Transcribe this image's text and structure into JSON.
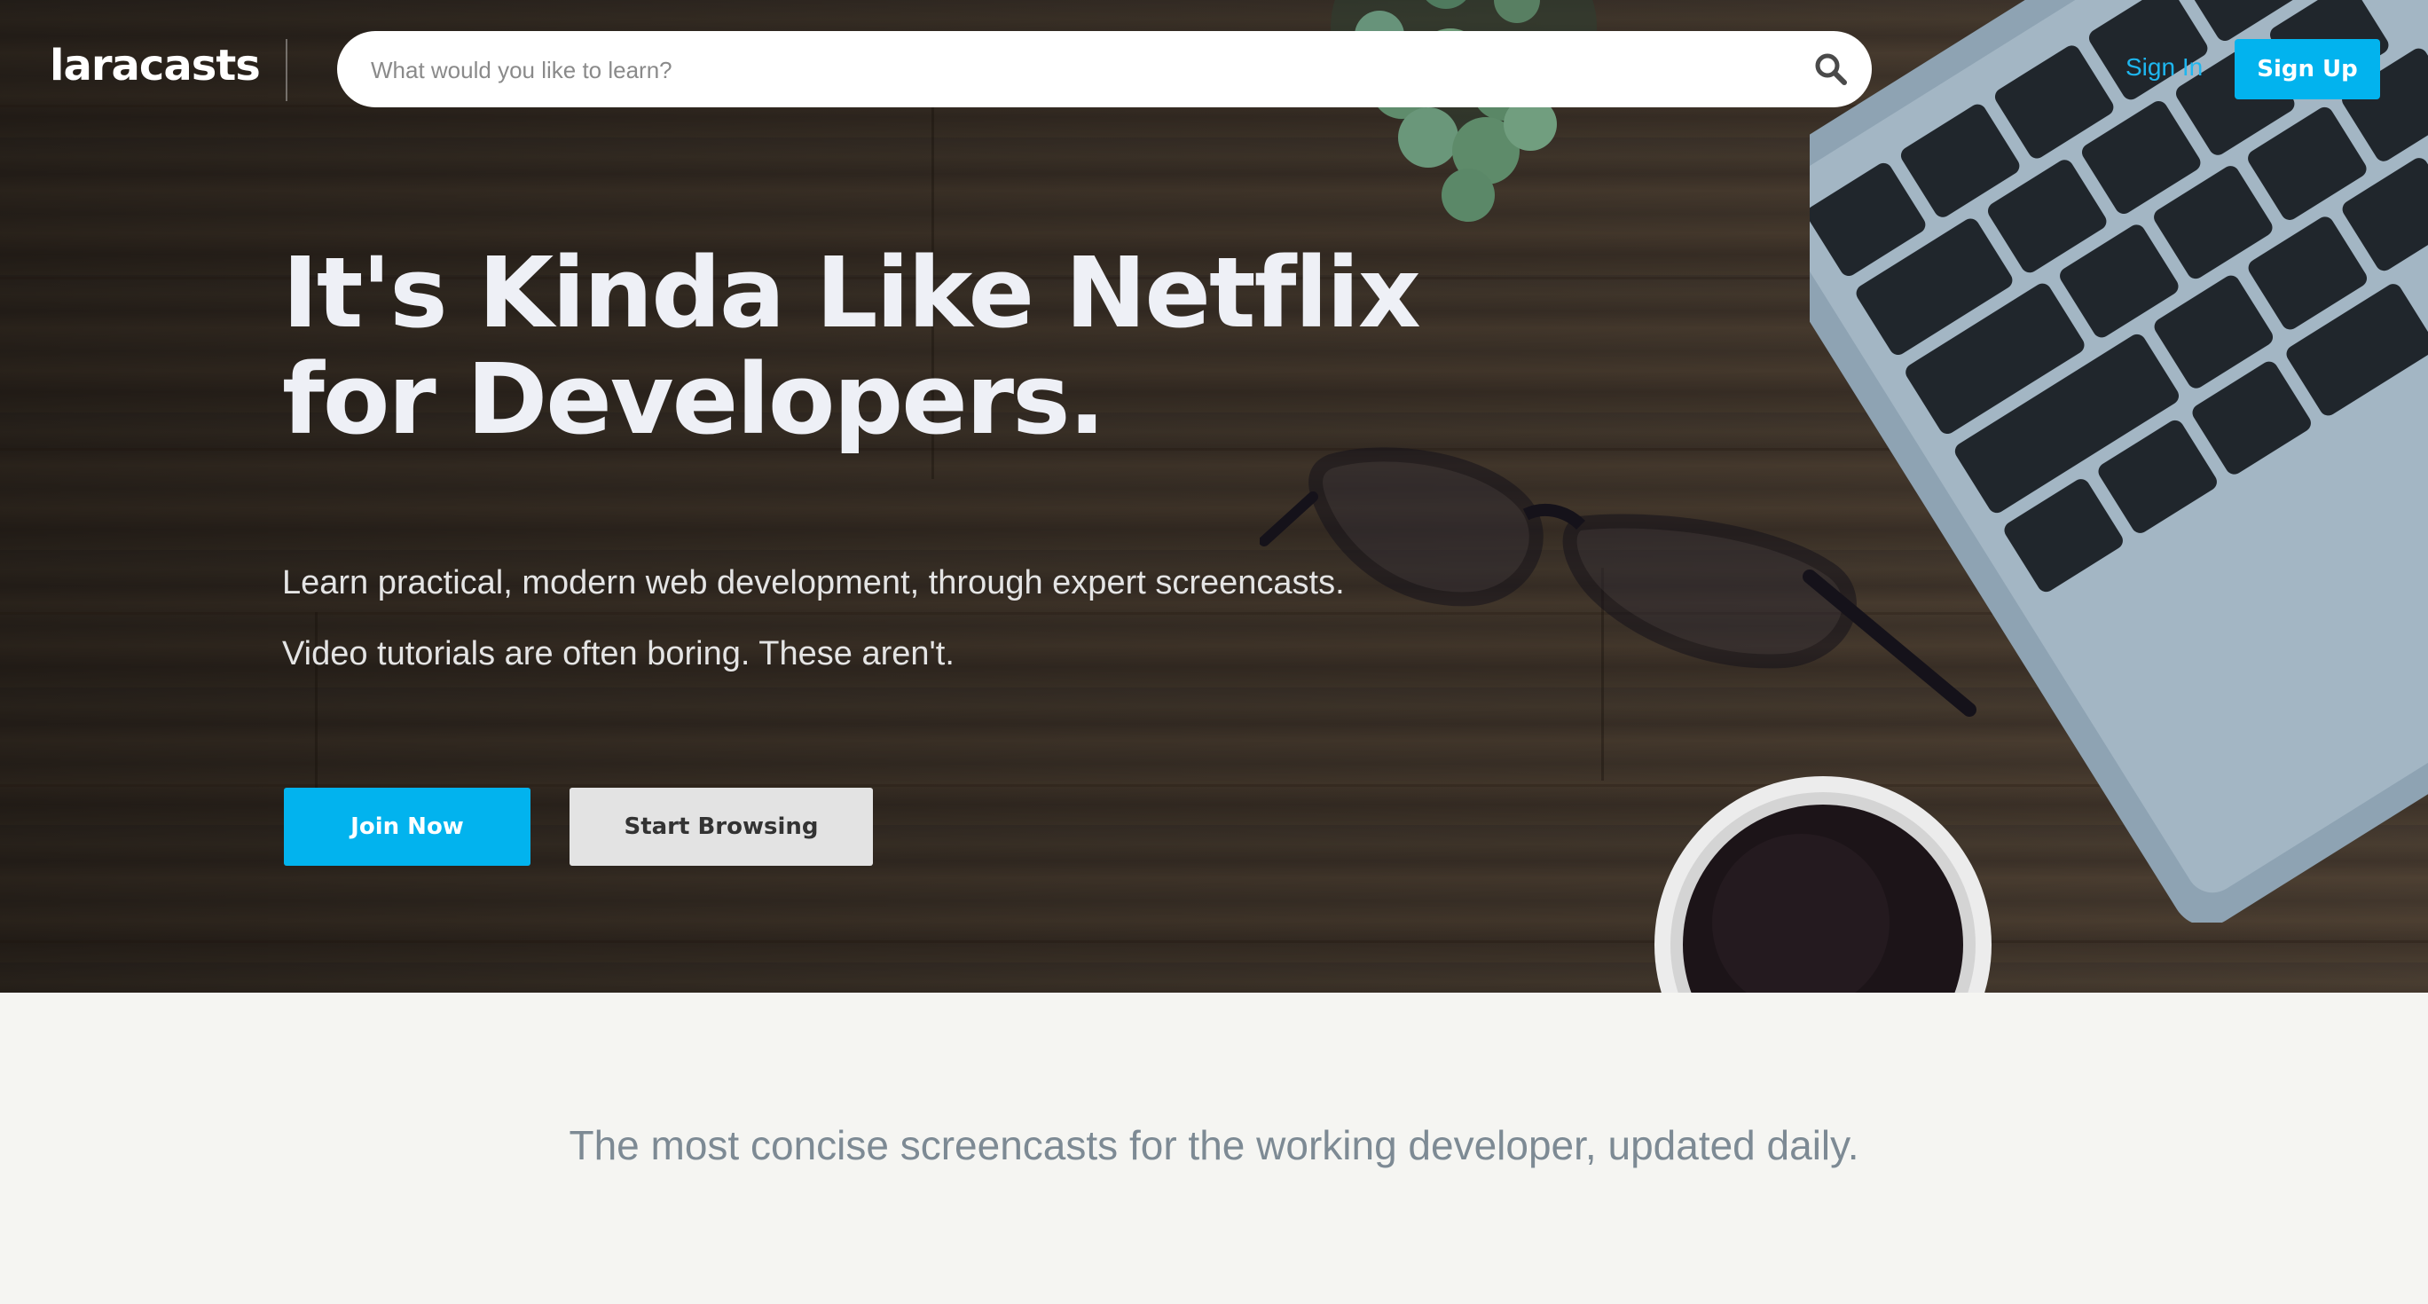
{
  "brand": {
    "logo_text": "laracasts"
  },
  "search": {
    "placeholder": "What would you like to learn?",
    "value": ""
  },
  "nav": {
    "sign_in_label": "Sign In",
    "sign_up_label": "Sign Up"
  },
  "hero": {
    "headline_line1": "It's Kinda Like Netflix",
    "headline_line2": "for Developers.",
    "subline_1": "Learn practical, modern web development, through expert screencasts.",
    "subline_2": "Video tutorials are often boring. These aren't.",
    "join_button_label": "Join Now",
    "browse_button_label": "Start Browsing"
  },
  "tagline": {
    "text": "The most concise screencasts for the working developer, updated daily."
  },
  "colors": {
    "accent": "#02b3ee",
    "link": "#1eb7f0",
    "secondary_button": "#e3e3e3",
    "section_background": "#f5f5f2",
    "tagline_text": "#7d8a94"
  },
  "icons": {
    "search": "search-icon"
  }
}
